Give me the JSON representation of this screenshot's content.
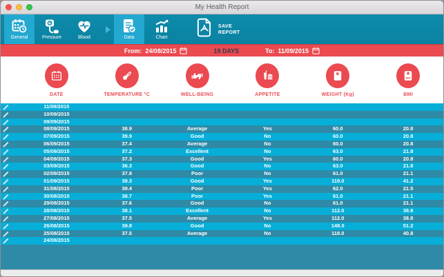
{
  "window": {
    "title": "My Health Report"
  },
  "toolbar": {
    "items": [
      {
        "label": "General",
        "icon": "calendar-clock-icon",
        "active": true
      },
      {
        "label": "Pressure",
        "icon": "blood-pressure-icon",
        "active": false
      },
      {
        "label": "Blood",
        "icon": "heart-pulse-icon",
        "active": false
      },
      {
        "label": "Data",
        "icon": "document-check-icon",
        "active": true
      },
      {
        "label": "Chart",
        "icon": "bar-chart-icon",
        "active": false
      }
    ],
    "save": {
      "line1": "SAVE",
      "line2": "REPORT",
      "icon": "pdf-icon"
    }
  },
  "range_bar": {
    "from_label": "From:",
    "from_value": "24/08/2015",
    "days": "19 DAYS",
    "to_label": "To:",
    "to_value": "11/09/2015"
  },
  "columns": [
    {
      "label": "DATE",
      "icon": "calendar-icon"
    },
    {
      "label": "TEMPERATURE °C",
      "icon": "thermometer-icon"
    },
    {
      "label": "WELL-BEING",
      "icon": "thumbs-up-down-icon"
    },
    {
      "label": "APPETITE",
      "icon": "drink-burger-icon"
    },
    {
      "label": "WEIGHT (Kg)",
      "icon": "weight-scale-icon"
    },
    {
      "label": "BMI",
      "icon": "bmi-scale-icon"
    }
  ],
  "table": {
    "rows": [
      {
        "date": "11/09/2015",
        "temperature": "",
        "wellbeing": "",
        "appetite": "",
        "weight": "",
        "bmi": ""
      },
      {
        "date": "10/09/2015",
        "temperature": "",
        "wellbeing": "",
        "appetite": "",
        "weight": "",
        "bmi": ""
      },
      {
        "date": "09/09/2015",
        "temperature": "",
        "wellbeing": "",
        "appetite": "",
        "weight": "",
        "bmi": ""
      },
      {
        "date": "08/09/2015",
        "temperature": "38.9",
        "wellbeing": "Average",
        "appetite": "Yes",
        "weight": "60.0",
        "bmi": "20.8"
      },
      {
        "date": "07/09/2015",
        "temperature": "39.9",
        "wellbeing": "Good",
        "appetite": "No",
        "weight": "60.0",
        "bmi": "20.8"
      },
      {
        "date": "06/09/2015",
        "temperature": "37.4",
        "wellbeing": "Average",
        "appetite": "No",
        "weight": "60.0",
        "bmi": "20.8"
      },
      {
        "date": "05/09/2015",
        "temperature": "37.2",
        "wellbeing": "Excellent",
        "appetite": "No",
        "weight": "63.0",
        "bmi": "21.8"
      },
      {
        "date": "04/09/2015",
        "temperature": "37.3",
        "wellbeing": "Good",
        "appetite": "Yes",
        "weight": "60.0",
        "bmi": "20.8"
      },
      {
        "date": "03/09/2015",
        "temperature": "36.3",
        "wellbeing": "Good",
        "appetite": "No",
        "weight": "63.0",
        "bmi": "21.8"
      },
      {
        "date": "02/09/2015",
        "temperature": "37.8",
        "wellbeing": "Poor",
        "appetite": "No",
        "weight": "61.0",
        "bmi": "21.1"
      },
      {
        "date": "01/09/2015",
        "temperature": "39.3",
        "wellbeing": "Good",
        "appetite": "Yes",
        "weight": "119.0",
        "bmi": "41.2"
      },
      {
        "date": "31/08/2015",
        "temperature": "39.4",
        "wellbeing": "Poor",
        "appetite": "Yes",
        "weight": "62.0",
        "bmi": "21.5"
      },
      {
        "date": "30/08/2015",
        "temperature": "38.7",
        "wellbeing": "Poor",
        "appetite": "Yes",
        "weight": "61.0",
        "bmi": "21.1"
      },
      {
        "date": "29/08/2015",
        "temperature": "37.6",
        "wellbeing": "Good",
        "appetite": "No",
        "weight": "61.0",
        "bmi": "21.1"
      },
      {
        "date": "28/08/2015",
        "temperature": "38.1",
        "wellbeing": "Excellent",
        "appetite": "No",
        "weight": "112.0",
        "bmi": "38.8"
      },
      {
        "date": "27/08/2015",
        "temperature": "37.5",
        "wellbeing": "Average",
        "appetite": "Yes",
        "weight": "112.0",
        "bmi": "38.8"
      },
      {
        "date": "26/08/2015",
        "temperature": "39.8",
        "wellbeing": "Good",
        "appetite": "No",
        "weight": "148.0",
        "bmi": "51.2"
      },
      {
        "date": "25/08/2015",
        "temperature": "37.5",
        "wellbeing": "Average",
        "appetite": "No",
        "weight": "118.0",
        "bmi": "40.8"
      },
      {
        "date": "24/08/2015",
        "temperature": "",
        "wellbeing": "",
        "appetite": "",
        "weight": "",
        "bmi": ""
      }
    ]
  },
  "colors": {
    "accent_red": "#EA4A50",
    "toolbar_teal": "#0D86A5",
    "active_button": "#23A8D0",
    "row_light": "#06AED8",
    "row_dark": "#2E8AA6"
  }
}
